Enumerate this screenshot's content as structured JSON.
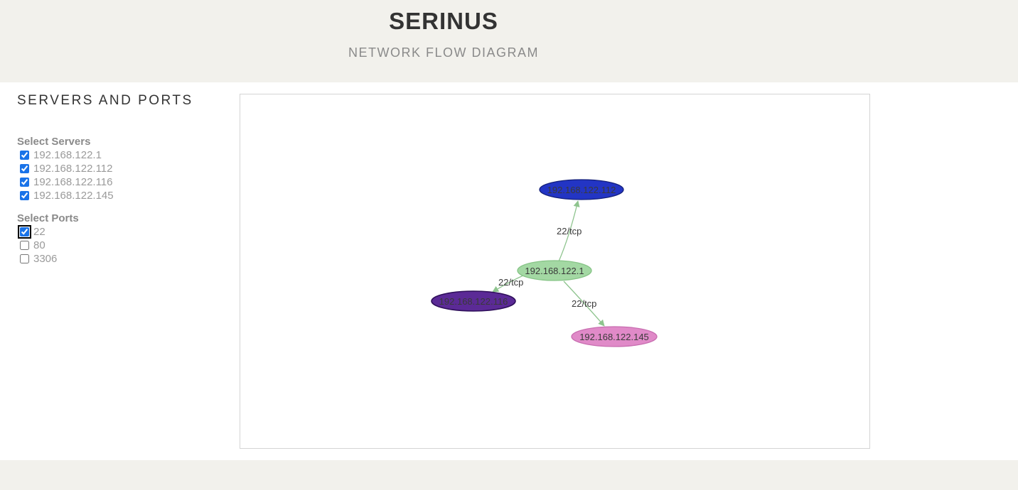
{
  "app": {
    "title": "SERINUS",
    "subtitle": "NETWORK FLOW DIAGRAM"
  },
  "sidebar": {
    "heading": "SERVERS AND PORTS",
    "servers": {
      "label": "Select Servers",
      "items": [
        {
          "label": "192.168.122.1",
          "checked": true
        },
        {
          "label": "192.168.122.112",
          "checked": true
        },
        {
          "label": "192.168.122.116",
          "checked": true
        },
        {
          "label": "192.168.122.145",
          "checked": true
        }
      ]
    },
    "ports": {
      "label": "Select Ports",
      "items": [
        {
          "label": "22",
          "checked": true
        },
        {
          "label": "80",
          "checked": false
        },
        {
          "label": "3306",
          "checked": false
        }
      ]
    }
  },
  "graph": {
    "nodes": [
      {
        "id": "n1",
        "label": "192.168.122.1",
        "fill": "#a3d8a3",
        "stroke": "#86c486"
      },
      {
        "id": "n112",
        "label": "192.168.122.112",
        "fill": "#2335c4",
        "stroke": "#14207a"
      },
      {
        "id": "n116",
        "label": "192.168.122.116",
        "fill": "#5b2a96",
        "stroke": "#2e0f5a"
      },
      {
        "id": "n145",
        "label": "192.168.122.145",
        "fill": "#e08ac8",
        "stroke": "#c86db0"
      }
    ],
    "edges": [
      {
        "from": "192.168.122.1",
        "to": "192.168.122.112",
        "label": "22/tcp"
      },
      {
        "from": "192.168.122.1",
        "to": "192.168.122.116",
        "label": "22/tcp"
      },
      {
        "from": "192.168.122.1",
        "to": "192.168.122.145",
        "label": "22/tcp"
      }
    ],
    "edge_color": "#8ec48e"
  }
}
